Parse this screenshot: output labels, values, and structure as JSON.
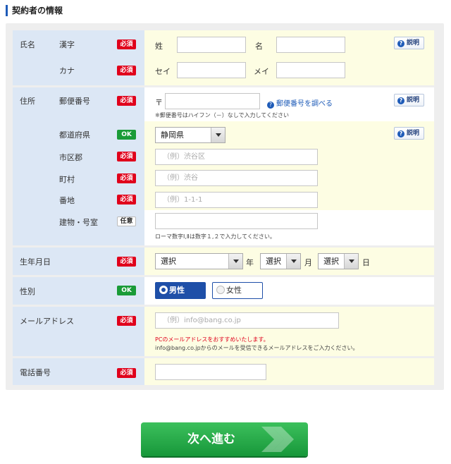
{
  "section_title": "契約者の情報",
  "badges": {
    "required": "必須",
    "ok": "OK",
    "optional": "任意"
  },
  "help_label": "説明",
  "name": {
    "label": "氏名",
    "kanji_label": "漢字",
    "kana_label": "カナ",
    "sei_kanji": "姓",
    "mei_kanji": "名",
    "sei_kana": "セイ",
    "mei_kana": "メイ",
    "sei_kanji_value": "",
    "mei_kanji_value": "",
    "sei_kana_value": "",
    "mei_kana_value": ""
  },
  "address": {
    "label": "住所",
    "postal_label": "郵便番号",
    "postal_mark": "〒",
    "postal_value": "",
    "postal_lookup_link": "郵便番号を調べる",
    "postal_note": "※郵便番号はハイフン（－）なしで入力してください",
    "prefecture_label": "都道府県",
    "prefecture_value": "静岡県",
    "city_label": "市区郡",
    "city_placeholder": "（例）渋谷区",
    "town_label": "町村",
    "town_placeholder": "（例）渋谷",
    "block_label": "番地",
    "block_placeholder": "（例）1-1-1",
    "building_label": "建物・号室",
    "building_value": "",
    "building_note": "ローマ数字Ⅰ,Ⅱは数字１,２で入力してください。"
  },
  "birthdate": {
    "label": "生年月日",
    "year_value": "選択",
    "year_unit": "年",
    "month_value": "選択",
    "month_unit": "月",
    "day_value": "選択",
    "day_unit": "日"
  },
  "gender": {
    "label": "性別",
    "male": "男性",
    "female": "女性",
    "selected": "男性"
  },
  "email": {
    "label": "メールアドレス",
    "placeholder": "（例）info@bang.co.jp",
    "note_red": "PCのメールアドレスをおすすめいたします。",
    "note": "info@bang.co.jpからのメールを受信できるメールアドレスをご入力ください。"
  },
  "phone": {
    "label": "電話番号",
    "value": ""
  },
  "next_button": "次へ進む",
  "colors": {
    "accent_blue": "#1e5bb8",
    "required_red": "#e0001b",
    "ok_green": "#1a9b37",
    "label_bg": "#dce7f5",
    "field_bg": "#fdfde3",
    "button_green": "#17973a"
  }
}
